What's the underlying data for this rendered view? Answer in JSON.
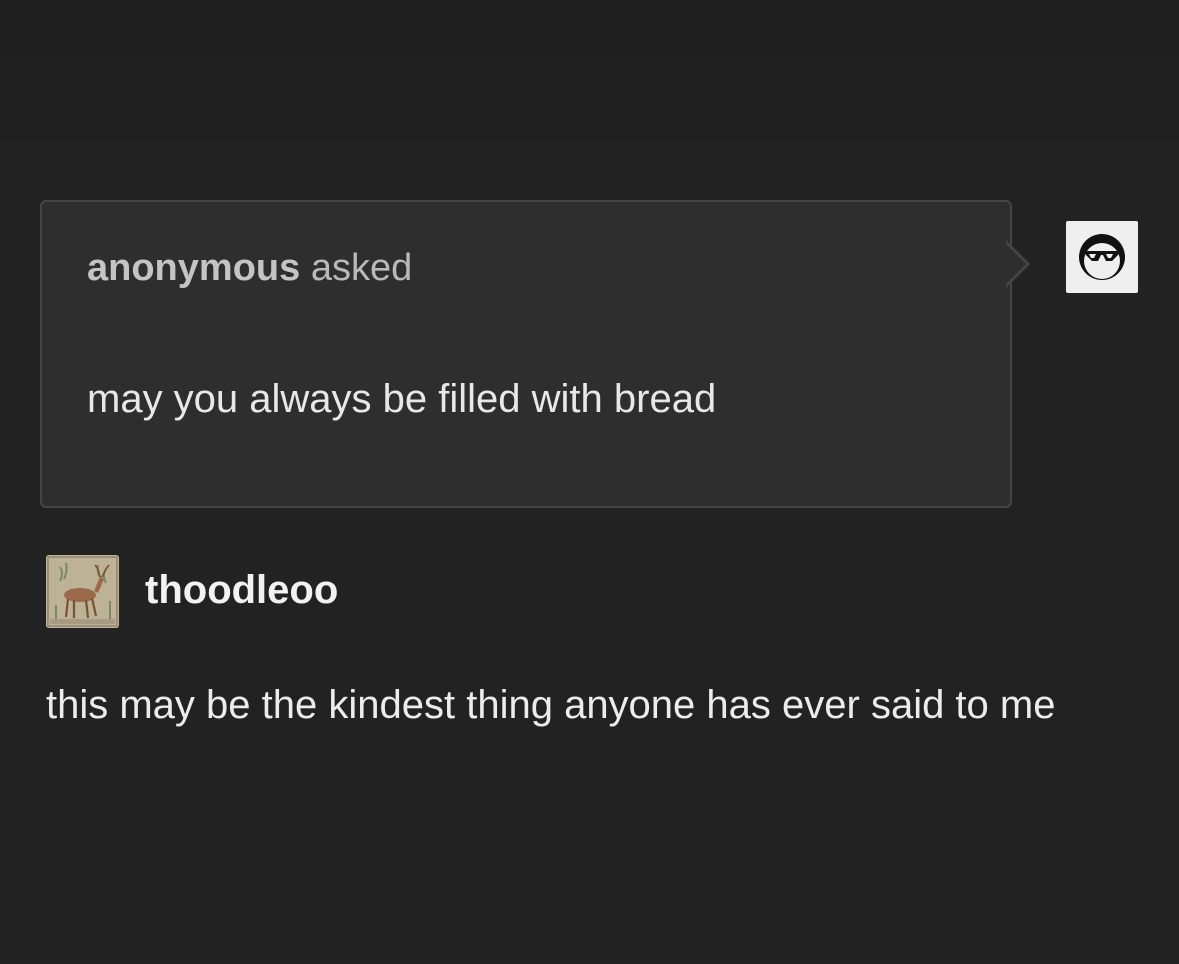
{
  "ask": {
    "asker_name": "anonymous",
    "asker_verb": "asked",
    "question": "may you always be filled with bread"
  },
  "icons": {
    "asker_avatar": "anonymous-sunglasses-icon",
    "responder_avatar": "medieval-deer-illustration-icon"
  },
  "answer": {
    "username": "thoodleoo",
    "text": "this may be the kindest thing anyone has ever said to me"
  },
  "colors": {
    "background": "#222222",
    "ask_box": "#2e2e2e",
    "text": "#ececec"
  }
}
